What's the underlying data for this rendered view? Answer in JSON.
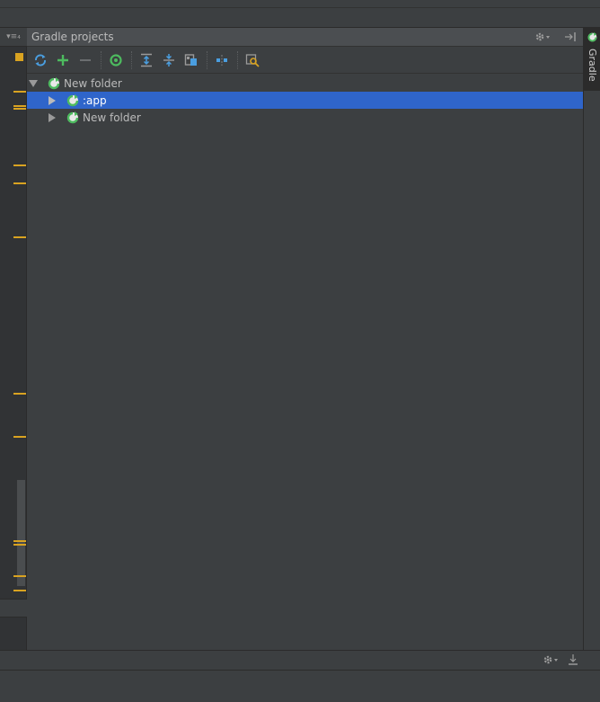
{
  "left_gutter": {
    "tab_label": "▾≡₄"
  },
  "panel": {
    "title": "Gradle projects",
    "header_icons": [
      "gear-icon",
      "hide-icon"
    ]
  },
  "toolbar": {
    "buttons": [
      "refresh-all-icon",
      "add-icon",
      "remove-icon",
      "execute-task-icon",
      "expand-all-icon",
      "collapse-all-icon",
      "attach-project-icon",
      "toggle-offline-icon",
      "settings-icon"
    ]
  },
  "tree": {
    "root": {
      "label": "New folder",
      "expanded": true
    },
    "children": [
      {
        "label": ":app",
        "selected": true
      },
      {
        "label": "New folder",
        "selected": false
      }
    ]
  },
  "right_stripe": {
    "tab_label": "Gradle"
  },
  "colors": {
    "background": "#3c3f41",
    "selection": "#2f65ca",
    "gradle_green": "#4dbb5f",
    "marker_yellow": "#d9a321"
  }
}
